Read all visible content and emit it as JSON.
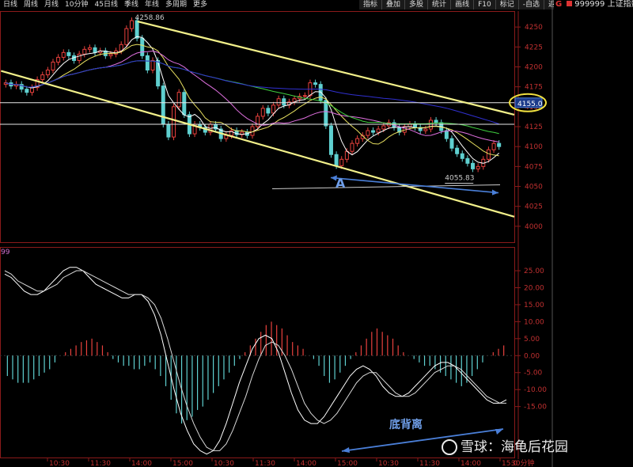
{
  "toolbar": {
    "periods": [
      "日线",
      "周线",
      "月线",
      "10分钟",
      "45日线",
      "季线",
      "年线",
      "多周期",
      "更多"
    ],
    "tools": [
      "指标",
      "叠加",
      "多股",
      "统计",
      "画线",
      "F10",
      "标记",
      "-自选",
      "返回"
    ]
  },
  "security": {
    "prefix": "G",
    "code": "999999",
    "name": "上证指数"
  },
  "colors": {
    "up": "#e8413d",
    "down": "#5fd0d0",
    "channel": "#f2f08a",
    "ma5": "#ffffff",
    "ma10": "#e8e060",
    "ma20": "#e070e0",
    "ma60": "#40d040",
    "ma120": "#3030d0",
    "macd_dif": "#ffffff",
    "arrow": "#4a7fd8",
    "highlight": "#f0e040"
  },
  "chart_data": [
    {
      "type": "candlestick",
      "panel": "price",
      "ylim": [
        3980,
        4270
      ],
      "y_ticks": [
        4000,
        4025,
        4050,
        4075,
        4100,
        4125,
        4150,
        4175,
        4200,
        4225,
        4250
      ],
      "close": [
        4180,
        4176,
        4178,
        4172,
        4168,
        4174,
        4184,
        4190,
        4196,
        4206,
        4212,
        4218,
        4214,
        4208,
        4216,
        4222,
        4224,
        4218,
        4220,
        4214,
        4216,
        4220,
        4228,
        4248,
        4258,
        4236,
        4214,
        4196,
        4208,
        4176,
        4128,
        4112,
        4150,
        4168,
        4140,
        4116,
        4128,
        4124,
        4118,
        4128,
        4122,
        4110,
        4114,
        4120,
        4115,
        4118,
        4114,
        4125,
        4138,
        4148,
        4142,
        4152,
        4160,
        4152,
        4156,
        4160,
        4163,
        4164,
        4180,
        4178,
        4158,
        4126,
        4090,
        4076,
        4084,
        4094,
        4104,
        4110,
        4114,
        4120,
        4118,
        4122,
        4126,
        4130,
        4124,
        4118,
        4125,
        4128,
        4124,
        4120,
        4122,
        4133,
        4130,
        4120,
        4110,
        4098,
        4091,
        4085,
        4079,
        4072,
        4075,
        4084,
        4096,
        4104,
        4100
      ],
      "channel_lines": [
        {
          "from": [
            0,
            4195
          ],
          "to": [
            95,
            4012
          ]
        },
        {
          "from": [
            26,
            4257
          ],
          "to": [
            95,
            4140
          ]
        }
      ],
      "horizontal_lines": [
        4155,
        4128
      ],
      "price_marker": "4155.0",
      "annotations": [
        {
          "label": "4258.86",
          "text": "4258.86"
        },
        {
          "label": "4055.83",
          "text": "4055.83"
        },
        {
          "label": "A",
          "text": "A"
        }
      ]
    },
    {
      "type": "bar",
      "panel": "macd",
      "ylim": [
        -30,
        32
      ],
      "y_ticks": [
        25.0,
        20.0,
        15.0,
        10.0,
        5.0,
        0.0,
        -5.0,
        -10.0,
        -15.0
      ],
      "y_tick_labels": [
        "25.00",
        "20.00",
        "15.00",
        "10.00",
        "5.00",
        "0.00",
        "-5.00",
        "-10.00",
        "-15.00"
      ],
      "histogram": [
        -6,
        -7,
        -8,
        -8,
        -8,
        -7,
        -6,
        -5,
        -4,
        -2,
        0,
        1,
        2,
        3,
        4,
        4.5,
        5,
        4,
        3,
        1,
        -1,
        -2,
        -3,
        -3,
        -4,
        -4,
        -3,
        -2,
        -4,
        -6,
        -9,
        -13,
        -17,
        -20,
        -19,
        -18,
        -16,
        -15,
        -13,
        -11,
        -9,
        -7,
        -5,
        -3,
        -1,
        1,
        3,
        5,
        7,
        9,
        10,
        9,
        8,
        6,
        4,
        3,
        2,
        0,
        -1,
        -3,
        -6,
        -8,
        -7,
        -5,
        -3,
        -1,
        1,
        3,
        5,
        7,
        8,
        7,
        6,
        5,
        3,
        1,
        0,
        -1,
        -2,
        -3,
        -3,
        -4,
        -5,
        -6,
        -7,
        -8,
        -9,
        -8,
        -6,
        -4,
        -2,
        0,
        1,
        2,
        3
      ],
      "dif": [
        24,
        23,
        21,
        19,
        18,
        18,
        19,
        21,
        23,
        25,
        26,
        26,
        25,
        23,
        21,
        20,
        19,
        18,
        17,
        17,
        18,
        18,
        16,
        12,
        6,
        -2,
        -10,
        -17,
        -22,
        -26,
        -28,
        -29,
        -28,
        -25,
        -20,
        -14,
        -8,
        -3,
        2,
        5,
        6,
        5,
        1,
        -5,
        -11,
        -16,
        -19,
        -20,
        -20,
        -18,
        -15,
        -12,
        -9,
        -6,
        -4,
        -3,
        -4,
        -6,
        -9,
        -11,
        -12,
        -12,
        -11,
        -9,
        -7,
        -5,
        -3,
        -2,
        -2,
        -3,
        -5,
        -7,
        -9,
        -11,
        -13,
        -14,
        -14,
        -13
      ],
      "dea": [
        25,
        24,
        22,
        21,
        20,
        19,
        19,
        20,
        21,
        23,
        24,
        25,
        25,
        24,
        23,
        22,
        21,
        20,
        19,
        18,
        18,
        18,
        17,
        15,
        11,
        5,
        -2,
        -9,
        -15,
        -20,
        -24,
        -27,
        -28,
        -28,
        -26,
        -22,
        -17,
        -12,
        -6,
        -1,
        3,
        4,
        3,
        0,
        -4,
        -9,
        -14,
        -17,
        -19,
        -20,
        -19,
        -17,
        -14,
        -11,
        -8,
        -6,
        -5,
        -5,
        -7,
        -9,
        -11,
        -12,
        -12,
        -11,
        -9,
        -7,
        -5,
        -4,
        -3,
        -3,
        -4,
        -6,
        -8,
        -10,
        -12,
        -13,
        -14,
        -14
      ],
      "annotations": [
        {
          "label": "底背离",
          "text": "底背离"
        }
      ]
    }
  ],
  "time_axis": [
    "10:30",
    "11:30",
    "14:00",
    "15:00",
    "10:30",
    "11:30",
    "14:00",
    "15:00",
    "10:30",
    "11:30",
    "14:00",
    "15:0"
  ],
  "time_axis_unit": "30分钟",
  "watermark": {
    "text": "雪球：海龟后花园"
  },
  "top_left_label": "99"
}
